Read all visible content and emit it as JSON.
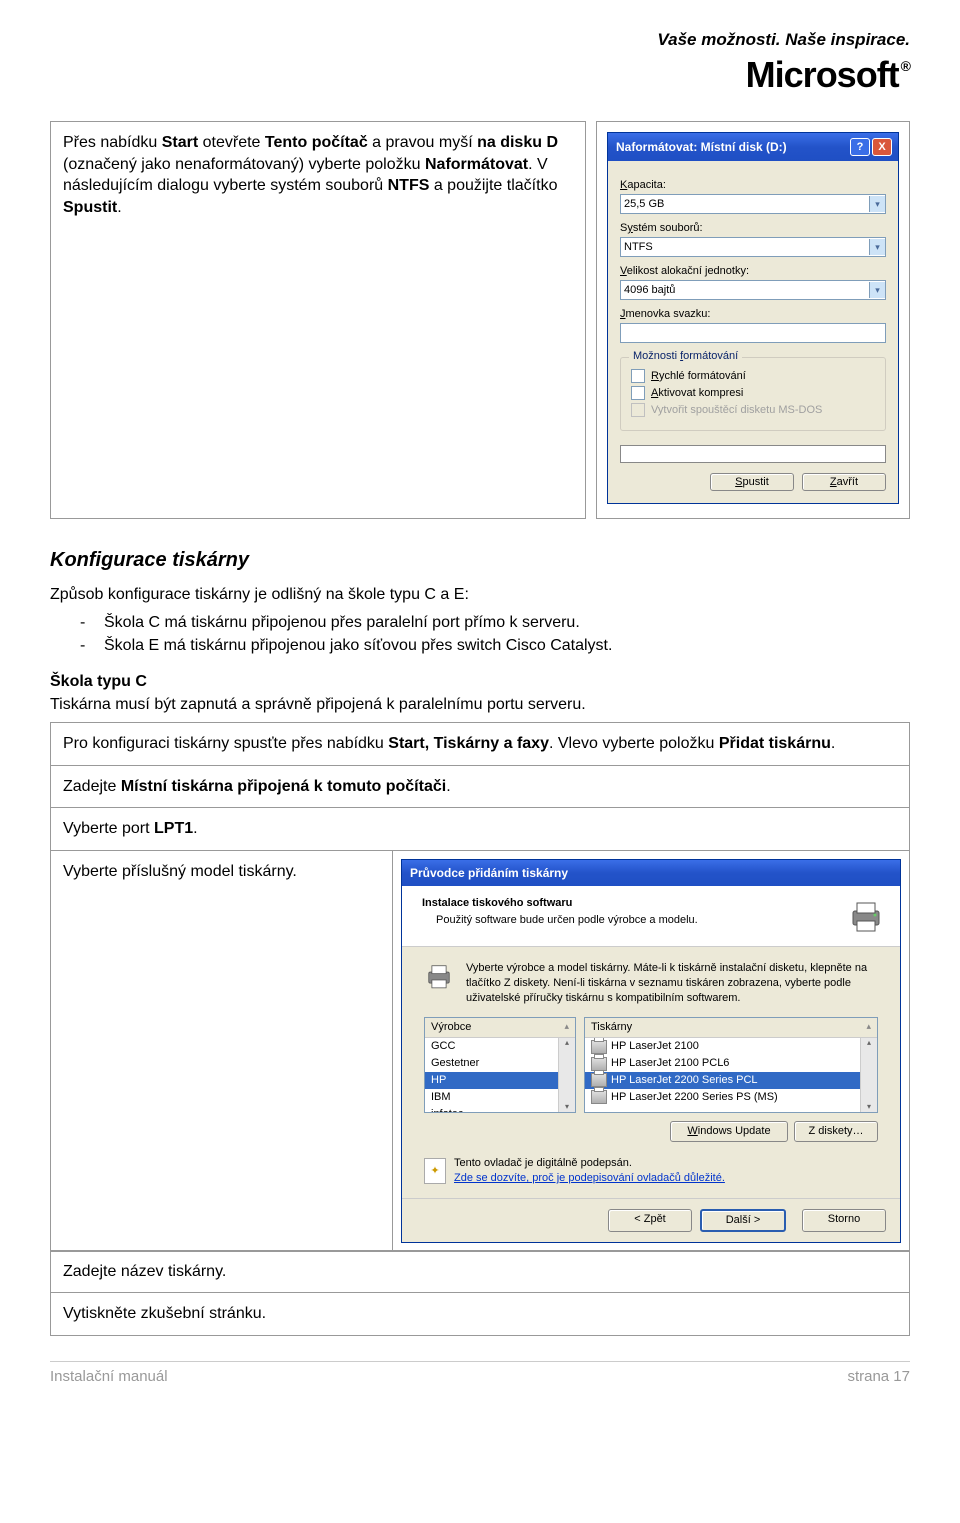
{
  "header": {
    "tagline": "Vaše možnosti. Naše inspirace.",
    "logo": "Microsoft"
  },
  "intro_cell": {
    "p1a": "Přes nabídku ",
    "p1b": "Start",
    "p1c": " otevřete ",
    "p1d": "Tento počítač",
    "p1e": " a pravou myší ",
    "p1f": "na disku D",
    "p1g": " (označený jako nenaformátovaný) vyberte položku ",
    "p1h": "Naformátovat",
    "p1i": ". V následujícím dialogu vyberte systém souborů ",
    "p1j": "NTFS",
    "p1k": " a použijte tlačítko ",
    "p1l": "Spustit",
    "p1m": "."
  },
  "format_dialog": {
    "title": "Naformátovat: Místní disk (D:)",
    "cap_label": "Kapacita:",
    "cap_value": "25,5 GB",
    "fs_label": "Systém souborů:",
    "fs_value": "NTFS",
    "au_label": "Velikost alokační jednotky:",
    "au_value": "4096 bajtů",
    "vol_label": "Jmenovka svazku:",
    "opts_title": "Možnosti formátování",
    "opt1": "Rychlé formátování",
    "opt2": "Aktivovat kompresi",
    "opt3": "Vytvořit spouštěcí disketu MS-DOS",
    "btn_start": "Spustit",
    "btn_close": "Zavřít"
  },
  "section_title": "Konfigurace tiskárny",
  "section_intro": "Způsob konfigurace tiskárny je odlišný na škole typu C a E:",
  "bullet1": "Škola C má tiskárnu připojenou přes paralelní port přímo k serveru.",
  "bullet2": "Škola E má tiskárnu připojenou jako síťovou přes switch Cisco Catalyst.",
  "subhead": "Škola typu C",
  "subhead_text": "Tiskárna musí být zapnutá a správně připojená k paralelnímu portu serveru.",
  "row_a1": "Pro konfiguraci tiskárny spusťte přes nabídku ",
  "row_a2": "Start, Tiskárny a faxy",
  "row_a3": ". Vlevo vyberte položku ",
  "row_a4": "Přidat tiskárnu",
  "row_a5": ".",
  "row_b1": "Zadejte ",
  "row_b2": "Místní tiskárna připojená k tomuto počítači",
  "row_b3": ".",
  "row_c1": "Vyberte port ",
  "row_c2": "LPT1",
  "row_c3": ".",
  "row_d": "Vyberte příslušný model tiskárny.",
  "row_e": "Zadejte název tiskárny.",
  "row_f": "Vytiskněte zkušební stránku.",
  "wizard": {
    "title": "Průvodce přidáním tiskárny",
    "h1": "Instalace tiskového softwaru",
    "h2": "Použitý software bude určen podle výrobce a modelu.",
    "instr": "Vyberte výrobce a model tiskárny. Máte-li k tiskárně instalační disketu, klepněte na tlačítko Z diskety. Není-li tiskárna v seznamu tiskáren zobrazena, vyberte podle uživatelské příručky tiskárnu s kompatibilním softwarem.",
    "col_vendor": "Výrobce",
    "col_printer": "Tiskárny",
    "vendors": [
      "GCC",
      "Gestetner",
      "HP",
      "IBM",
      "infotec"
    ],
    "printers": [
      "HP LaserJet 2100",
      "HP LaserJet 2100 PCL6",
      "HP LaserJet 2200 Series PCL",
      "HP LaserJet 2200 Series PS (MS)"
    ],
    "btn_wu": "Windows Update",
    "btn_disk": "Z diskety…",
    "sign_text": "Tento ovladač je digitálně podepsán.",
    "sign_link": "Zde se dozvíte, proč je podepisování ovladačů důležité.",
    "btn_back": "< Zpět",
    "btn_next": "Další >",
    "btn_cancel": "Storno"
  },
  "footer_left": "Instalační manuál",
  "footer_right": "strana 17"
}
